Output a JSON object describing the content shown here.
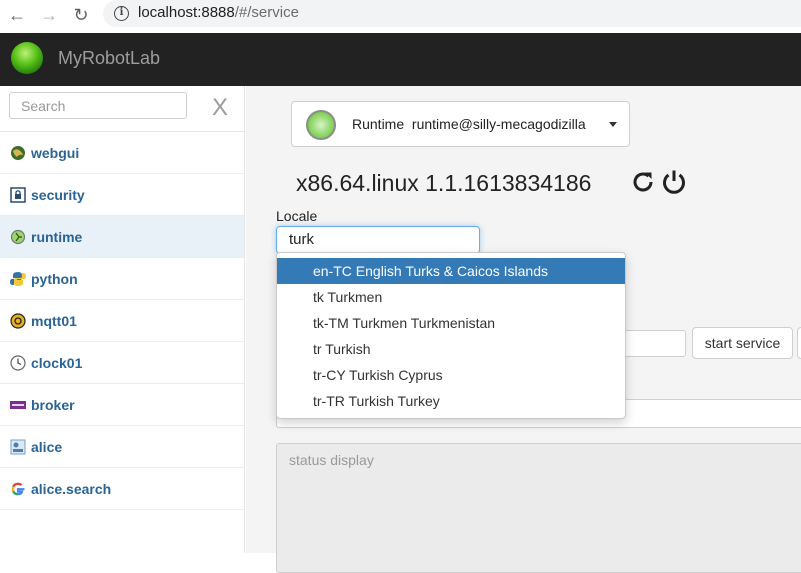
{
  "browser": {
    "url_host": "localhost:8888",
    "url_path": "/#/service"
  },
  "app": {
    "title": "MyRobotLab"
  },
  "sidebar": {
    "search_placeholder": "Search",
    "close_label": "X",
    "items": [
      {
        "label": "webgui",
        "icon": "globe-icon"
      },
      {
        "label": "security",
        "icon": "lock-icon"
      },
      {
        "label": "runtime",
        "icon": "runtime-icon",
        "active": true
      },
      {
        "label": "python",
        "icon": "python-icon"
      },
      {
        "label": "mqtt01",
        "icon": "mqtt-icon"
      },
      {
        "label": "clock01",
        "icon": "clock-icon"
      },
      {
        "label": "broker",
        "icon": "broker-icon"
      },
      {
        "label": "alice",
        "icon": "alice-icon"
      },
      {
        "label": "alice.search",
        "icon": "google-icon"
      }
    ]
  },
  "main": {
    "service_select": {
      "type": "Runtime",
      "name": "runtime@silly-mecagodizilla"
    },
    "platform": "x86.64.linux 1.1.1613834186",
    "locale_label": "Locale",
    "locale_value": "turk",
    "start_button": "start service",
    "status_placeholder": "status display"
  },
  "locale_dropdown": {
    "options": [
      {
        "label": "en-TC English Turks & Caicos Islands",
        "highlighted": true
      },
      {
        "label": "tk Turkmen"
      },
      {
        "label": "tk-TM Turkmen Turkmenistan"
      },
      {
        "label": "tr Turkish"
      },
      {
        "label": "tr-CY Turkish Cyprus"
      },
      {
        "label": "tr-TR Turkish Turkey"
      }
    ]
  },
  "colors": {
    "accent": "#337ab7",
    "link": "#2a6496",
    "header_bg": "#222222"
  }
}
